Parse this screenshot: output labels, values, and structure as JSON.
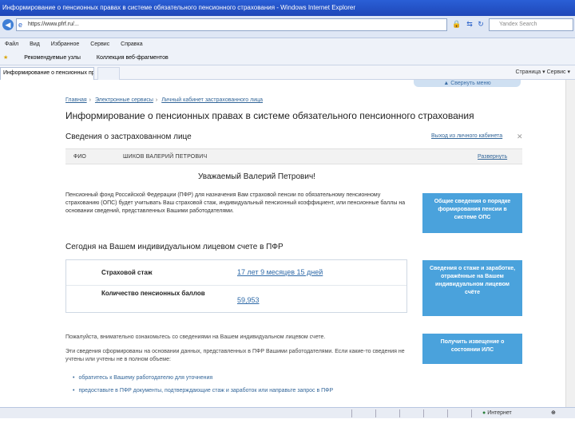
{
  "window": {
    "title": "Информирование о пенсионных правах в системе обязательного пенсионного страхования - Windows Internet Explorer"
  },
  "addressbar": {
    "url": "https://www.pfrf.ru/...",
    "search_placeholder": "Yandex Search"
  },
  "menubar": {
    "items": [
      "Файл",
      "Вид",
      "Избранное",
      "Сервис",
      "Справка"
    ]
  },
  "favbar": {
    "items": [
      "Рекомендуемые узлы",
      "Коллекция веб-фрагментов"
    ]
  },
  "tabbar": {
    "tab_label": "Информирование о пенсионных правах...",
    "right_items": "Страница ▾   Сервис ▾"
  },
  "page": {
    "menu_toggle": "▲ Свернуть меню",
    "breadcrumbs": [
      "Главная",
      "Электронные сервисы",
      "Личный кабинет застрахованного лица"
    ],
    "title": "Информирование о пенсионных правах в системе обязательного пенсионного страхования",
    "insured_header": "Сведения о застрахованном лице",
    "exit_link": "Выход из личного кабинета",
    "fio_label": "ФИО",
    "fio_value": "ШИКОВ ВАЛЕРИЙ ПЕТРОВИЧ",
    "expand_link": "Развернуть",
    "greeting": "Уважаемый Валерий Петрович!",
    "intro_text": "Пенсионный фонд Российской Федерации (ПФР) для назначения Вам страховой пенсии по обязательному пенсионному страхованию (ОПС) будет учитывать Ваш страховой стаж, индивидуальный пенсионный коэффициент, или пенсионные баллы на основании сведений, представленных Вашими работодателями.",
    "account_header": "Сегодня на Вашем индивидуальном лицевом счете в ПФР",
    "rows": [
      {
        "label": "Страховой стаж",
        "value": "17 лет 9 месяцев 15 дней"
      },
      {
        "label": "Количество пенсионных баллов",
        "value": "59,953"
      }
    ],
    "para1": "Пожалуйста, внимательно ознакомьтесь со сведениями на Вашем индивидуальном лицевом счете.",
    "para2": "Эти сведения сформированы на основании данных, представленных в ПФР Вашими работодателями. Если какие-то сведения не учтены или учтены не в полном объеме:",
    "bullets": [
      "обратитесь к Вашему работодателю для уточнения",
      "предоставьте в ПФР документы, подтверждающие стаж и заработок или направьте запрос в ПФР"
    ],
    "side_boxes": [
      "Общие сведения о порядке формирования пенсии в системе ОПС",
      "Сведения о стаже и заработке, отражённые на Вашем индивидуальном лицевом счёте",
      "Получить извещение о состоянии ИЛС"
    ]
  },
  "statusbar": {
    "zone": "Интернет"
  }
}
